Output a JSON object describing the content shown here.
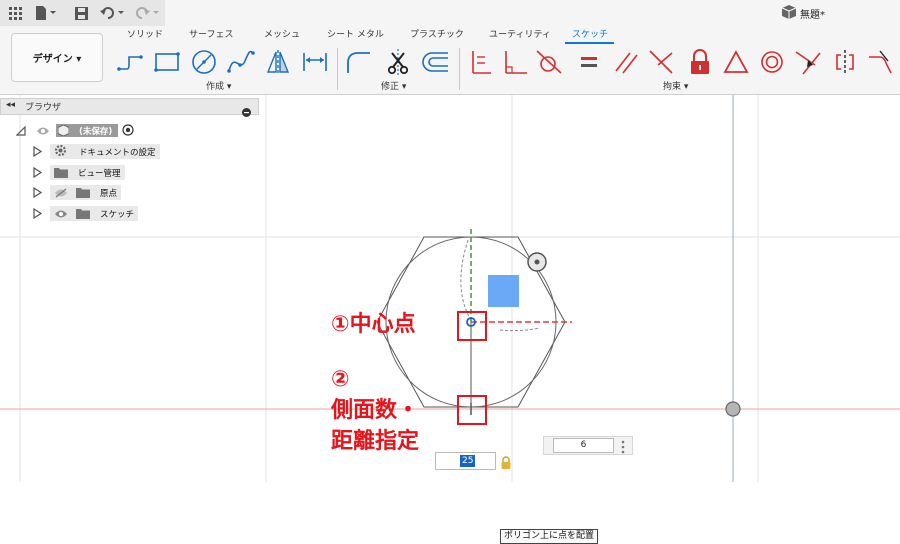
{
  "app": {
    "doc_title": "無題*",
    "colors": {
      "accent": "#0a78d7",
      "annotation": "#e8141c",
      "x_axis": "#e53935",
      "y_axis": "#43a047",
      "selection": "#1565c0"
    },
    "toolbar_icons": [
      "apps-grid-icon",
      "file-icon",
      "save-icon",
      "undo-icon",
      "redo-icon",
      "cube-icon"
    ]
  },
  "ribbon": {
    "workspace_label": "デザイン ▾",
    "tabs": [
      "ソリッド",
      "サーフェス",
      "メッシュ",
      "シート メタル",
      "プラスチック",
      "ユーティリティ",
      "スケッチ"
    ],
    "active_tab": "スケッチ",
    "groups": {
      "create": "作成 ▾",
      "modify": "修正 ▾",
      "constraints": "拘束 ▾"
    },
    "create_tools": [
      "line-tool-icon",
      "rectangle-tool-icon",
      "circle-tool-icon",
      "spline-tool-icon",
      "mirror-tool-icon",
      "dimension-tool-icon"
    ],
    "modify_tools": [
      "fillet-tool-icon",
      "trim-tool-icon",
      "offset-tool-icon"
    ],
    "constraint_tools": [
      "horizontal-vertical-icon",
      "perpendicular-icon",
      "tangent-icon",
      "equal-icon",
      "parallel-icon",
      "coincident-icon",
      "lock-icon",
      "triangle-icon",
      "concentric-icon",
      "midpoint-icon",
      "symmetry-icon",
      "curvature-icon"
    ]
  },
  "browser": {
    "title": "ブラウザ",
    "root": {
      "label": "(未保存)"
    },
    "items": [
      {
        "label": "ドキュメントの設定",
        "icon": "gear-icon"
      },
      {
        "label": "ビュー管理",
        "icon": "folder-icon"
      },
      {
        "label": "原点",
        "icon": "folder-icon"
      },
      {
        "label": "スケッチ",
        "icon": "folder-icon"
      }
    ]
  },
  "sketch": {
    "sides_value": "6",
    "distance_value": "25",
    "tooltip": "ポリゴン上に点を配置"
  },
  "annotations": {
    "step1": "①中心点",
    "step2_num": "②",
    "step2_line1": "側面数・",
    "step2_line2": "距離指定"
  }
}
